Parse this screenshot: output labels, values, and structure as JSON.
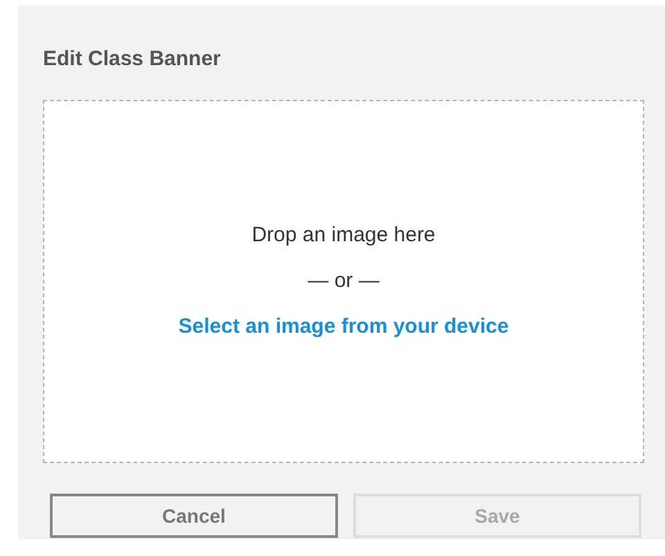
{
  "dialog": {
    "title": "Edit Class Banner"
  },
  "dropzone": {
    "prompt": "Drop an image here",
    "separator": "— or —",
    "link": "Select an image from your device"
  },
  "buttons": [
    {
      "label": "Cancel",
      "disabled": false
    },
    {
      "label": "Save",
      "disabled": true
    }
  ]
}
